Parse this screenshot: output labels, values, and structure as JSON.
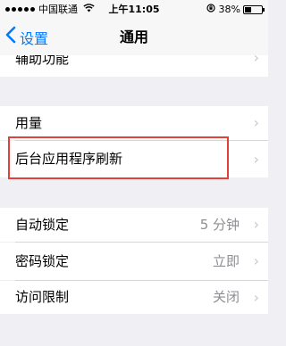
{
  "status_bar": {
    "carrier": "中国联通",
    "time": "上午11:05",
    "battery": "38%",
    "battery_level": 0.38
  },
  "nav": {
    "back_label": "设置",
    "title": "通用"
  },
  "rows": {
    "accessibility": {
      "label": "辅助功能"
    },
    "usage": {
      "label": "用量"
    },
    "background_refresh": {
      "label": "后台应用程序刷新"
    },
    "auto_lock": {
      "label": "自动锁定",
      "value": "5 分钟"
    },
    "passcode_lock": {
      "label": "密码锁定",
      "value": "立即"
    },
    "restrictions": {
      "label": "访问限制",
      "value": "关闭"
    }
  },
  "colors": {
    "accent": "#007aff",
    "highlight_border": "#e2403b",
    "group_background": "#efeff4"
  },
  "icons": {
    "back": "chevron-left-icon",
    "disclosure": "chevron-right-icon",
    "wifi": "wifi-icon",
    "orientation_lock": "orientation-lock-icon",
    "battery": "battery-icon"
  }
}
